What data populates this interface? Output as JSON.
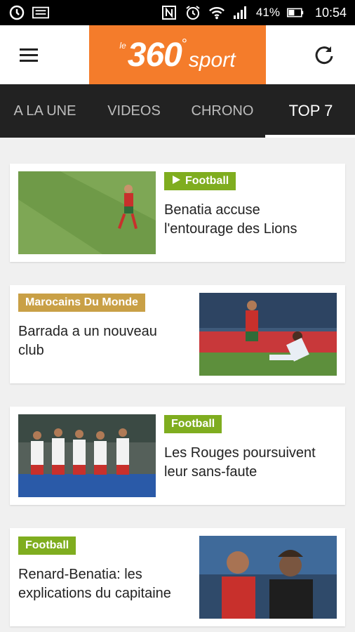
{
  "status_bar": {
    "battery": "41%",
    "time": "10:54"
  },
  "header": {
    "logo_number": "360",
    "logo_word": "sport",
    "logo_degree": "°",
    "logo_prefix": "le"
  },
  "tabs": [
    {
      "label": "A LA UNE",
      "active": false
    },
    {
      "label": "VIDEOS",
      "active": false
    },
    {
      "label": "CHRONO",
      "active": false
    },
    {
      "label": "TOP 7",
      "active": true
    }
  ],
  "articles": [
    {
      "category": "Football",
      "has_video": true,
      "title": "Benatia accuse l'entourage des Lions"
    },
    {
      "category": "Marocains Du Monde",
      "has_video": false,
      "title": "Barrada a un nouveau club"
    },
    {
      "category": "Football",
      "has_video": false,
      "title": "Les Rouges poursuivent leur sans-faute"
    },
    {
      "category": "Football",
      "has_video": false,
      "title": "Renard-Benatia: les explications du capitaine"
    }
  ],
  "colors": {
    "brand_orange": "#f47c2b",
    "tag_green": "#7fad1f",
    "tag_gold": "#c9a046",
    "tab_bar": "#222222"
  }
}
